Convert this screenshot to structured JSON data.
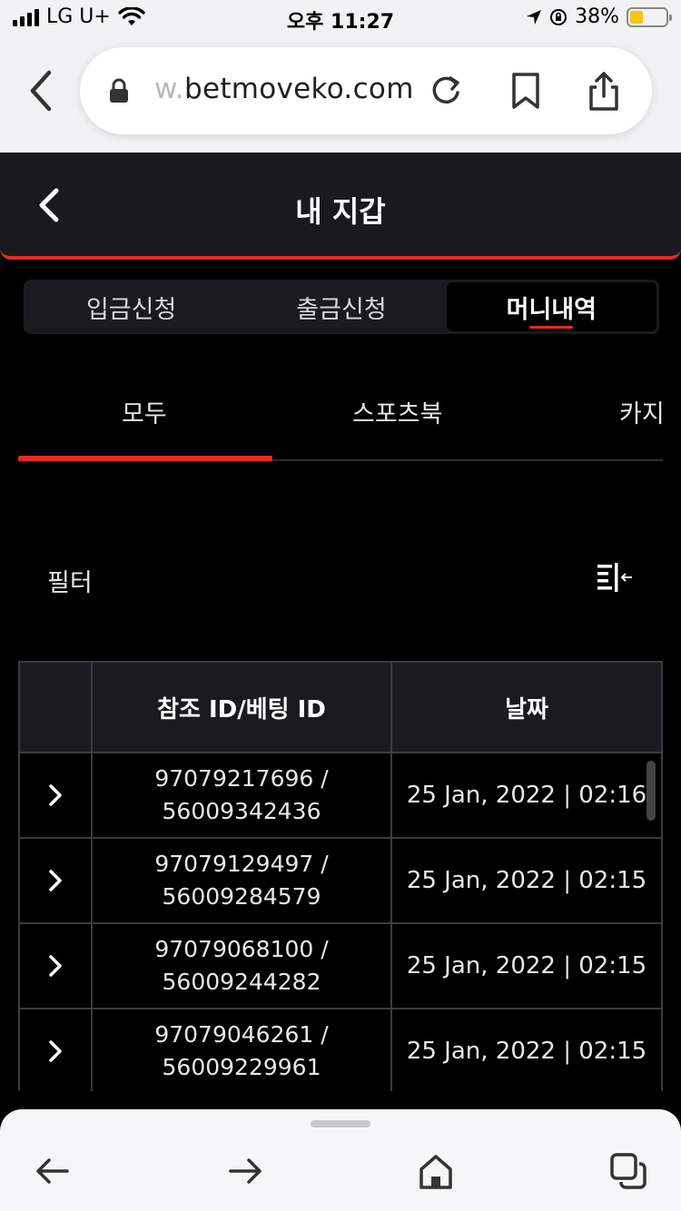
{
  "status_bar": {
    "carrier": "LG U+",
    "time": "오후 11:27",
    "battery_percent": "38%",
    "battery_level": 0.38,
    "battery_color": "#f5c518"
  },
  "browser": {
    "url_prefix": "w.",
    "url_domain": "betmoveko.com",
    "icons": [
      "chevron-left-icon",
      "lock-icon",
      "reload-icon",
      "bookmark-icon",
      "share-icon",
      "back-arrow-icon",
      "forward-arrow-icon",
      "home-icon",
      "tabs-icon"
    ]
  },
  "header": {
    "title": "내 지갑"
  },
  "segment_tabs": [
    {
      "label": "입금신청",
      "active": false
    },
    {
      "label": "출금신청",
      "active": false
    },
    {
      "label": "머니내역",
      "active": true
    }
  ],
  "sub_tabs": [
    {
      "label": "모두",
      "active": true
    },
    {
      "label": "스포츠북",
      "active": false
    },
    {
      "label": "카지",
      "active": false
    }
  ],
  "filter": {
    "label": "필터"
  },
  "table": {
    "columns": [
      "",
      "참조 ID/베팅 ID",
      "날짜"
    ],
    "rows": [
      {
        "ref_id": "97079217696 /",
        "bet_id": "56009342436",
        "date": "25 Jan, 2022 | 02:16"
      },
      {
        "ref_id": "97079129497 /",
        "bet_id": "56009284579",
        "date": "25 Jan, 2022 | 02:15"
      },
      {
        "ref_id": "97079068100 /",
        "bet_id": "56009244282",
        "date": "25 Jan, 2022 | 02:15"
      },
      {
        "ref_id": "97079046261 /",
        "bet_id": "56009229961",
        "date": "25 Jan, 2022 | 02:15"
      }
    ]
  },
  "colors": {
    "accent": "#e32b21",
    "background": "#000000",
    "panel": "#1a1a1e"
  }
}
